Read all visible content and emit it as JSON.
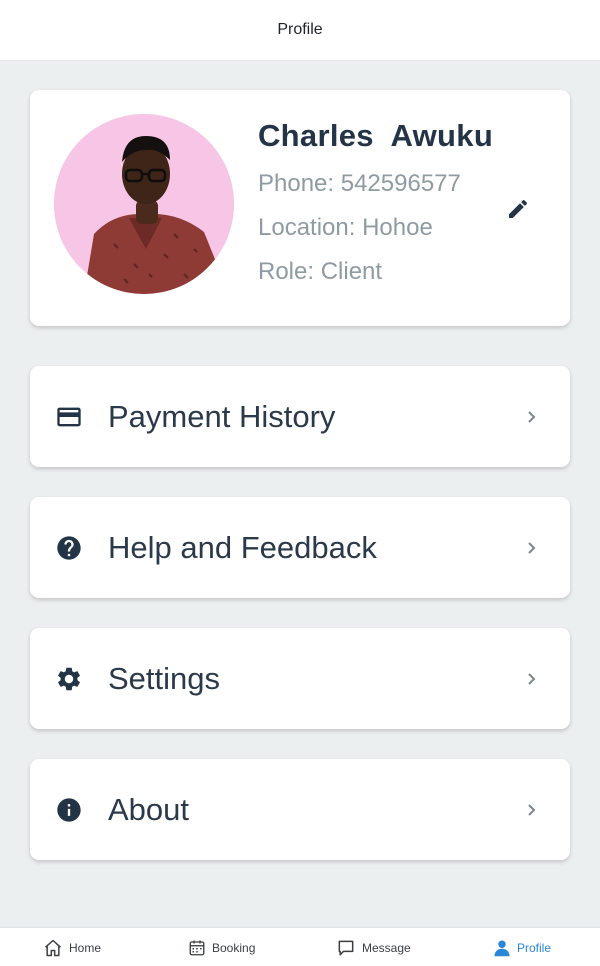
{
  "header": {
    "title": "Profile"
  },
  "profile": {
    "name": "Charles  Awuku",
    "phone": "Phone: 542596577",
    "location": "Location: Hohoe",
    "role": "Role: Client"
  },
  "menu": [
    {
      "label": "Payment History",
      "icon": "credit-card-icon"
    },
    {
      "label": "Help and Feedback",
      "icon": "help-circle-icon"
    },
    {
      "label": "Settings",
      "icon": "gear-icon"
    },
    {
      "label": "About",
      "icon": "info-icon"
    }
  ],
  "nav": [
    {
      "label": "Home",
      "icon": "home-icon"
    },
    {
      "label": "Booking",
      "icon": "calendar-icon"
    },
    {
      "label": "Message",
      "icon": "chat-icon"
    },
    {
      "label": "Profile",
      "icon": "person-icon"
    }
  ],
  "colors": {
    "accent": "#2a86d6",
    "text": "#2b3a4a",
    "muted": "#8f9ba3",
    "background": "#eceff0",
    "avatar_bg": "#f7c6e6"
  }
}
